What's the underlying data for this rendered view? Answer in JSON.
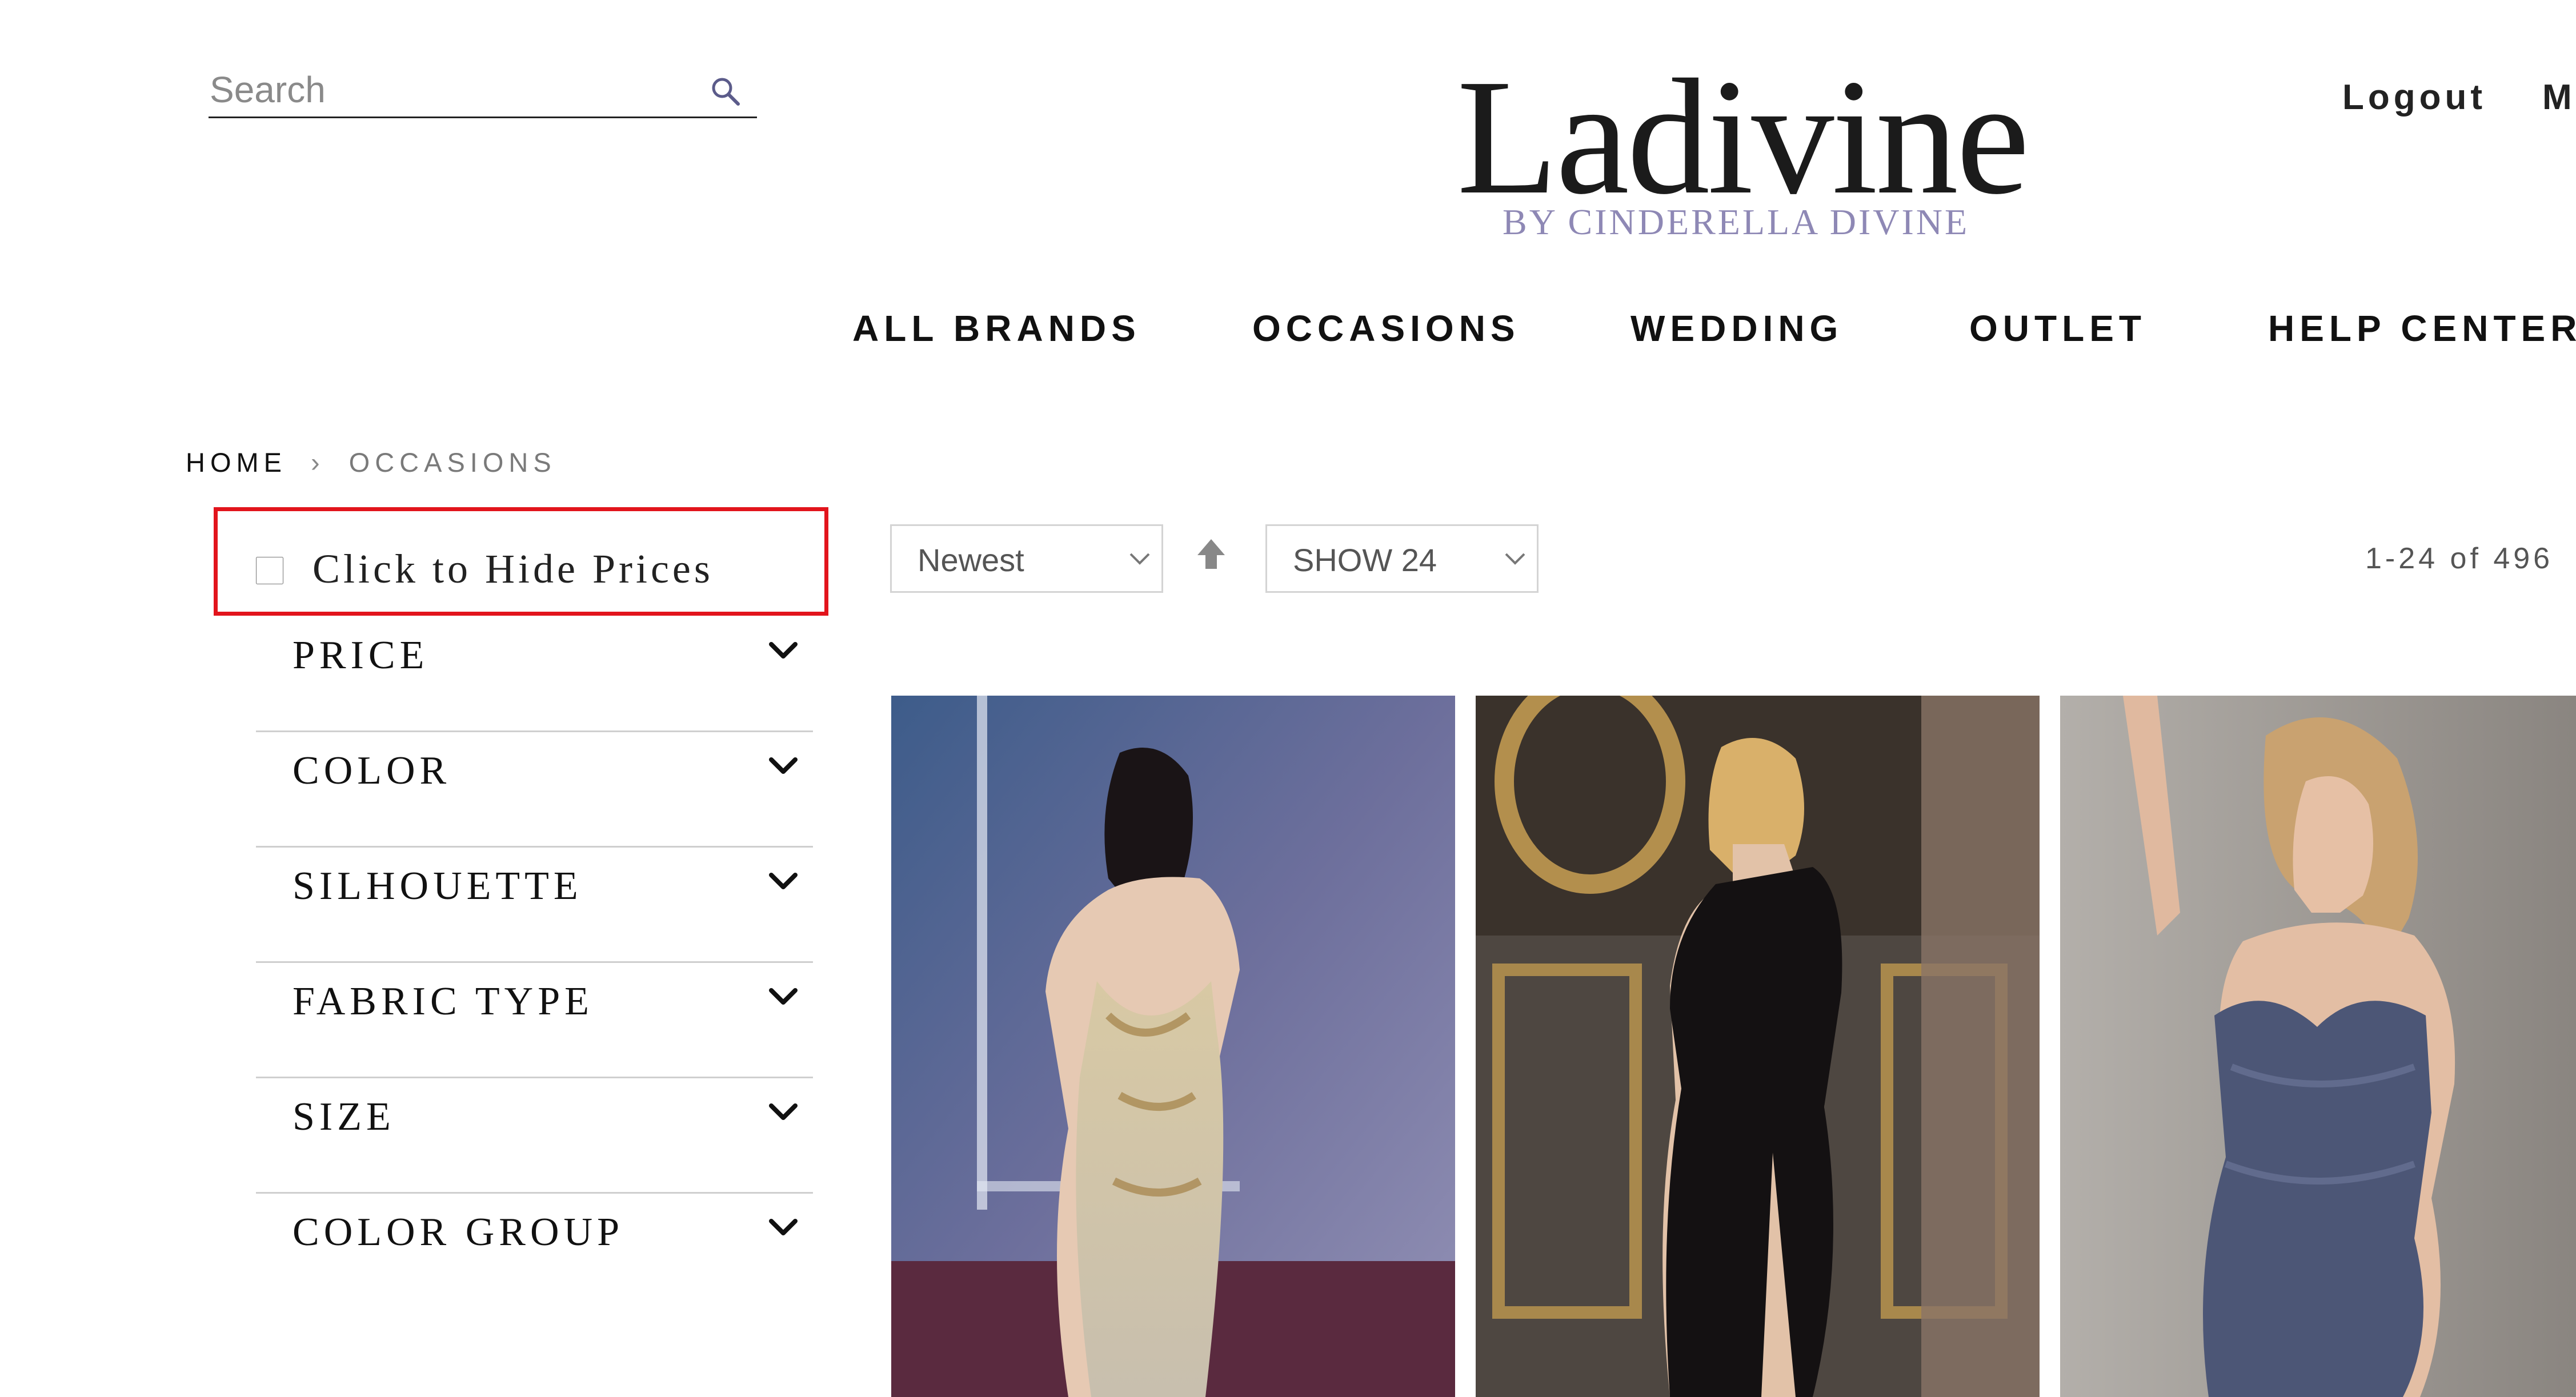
{
  "header": {
    "search_placeholder": "Search",
    "logo_title": "Ladivine",
    "logo_subtitle": "BY CINDERELLA DIVINE",
    "logout_label": "Logout",
    "more_label": "M"
  },
  "nav": {
    "items": [
      {
        "label": "ALL BRANDS"
      },
      {
        "label": "OCCASIONS"
      },
      {
        "label": "WEDDING"
      },
      {
        "label": "OUTLET"
      },
      {
        "label": "HELP CENTER"
      }
    ]
  },
  "breadcrumb": {
    "home": "HOME",
    "separator": "›",
    "current": "OCCASIONS"
  },
  "sidebar": {
    "hide_prices_label": "Click to Hide Prices",
    "filters": [
      {
        "label": "PRICE"
      },
      {
        "label": "COLOR"
      },
      {
        "label": "SILHOUETTE"
      },
      {
        "label": "FABRIC TYPE"
      },
      {
        "label": "SIZE"
      },
      {
        "label": "COLOR GROUP"
      }
    ]
  },
  "toolbar": {
    "sort_value": "Newest",
    "show_value": "SHOW 24",
    "result_count": "1-24 of 496"
  },
  "colors": {
    "accent_purple": "#8e88b5",
    "highlight_red": "#e2141c"
  },
  "icons": {
    "search": "search-icon",
    "sort_direction": "arrow-up-icon",
    "filter_toggle": "chevron-down-icon"
  }
}
